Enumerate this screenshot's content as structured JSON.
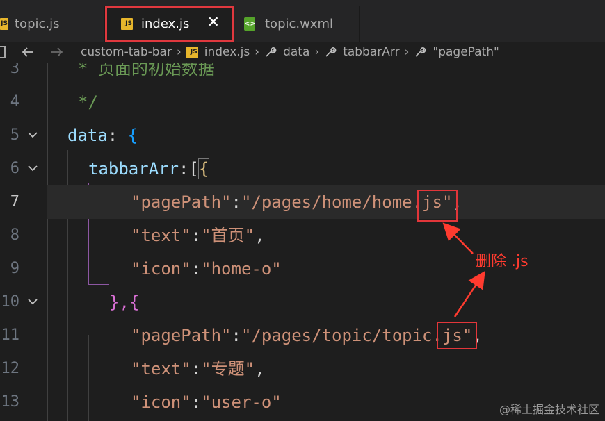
{
  "tabs": [
    {
      "label": "topic.js",
      "icon": "js-file-icon"
    },
    {
      "label": "index.js",
      "icon": "js-file-icon",
      "active": true
    },
    {
      "label": "topic.wxml",
      "icon": "wxml-file-icon"
    }
  ],
  "breadcrumb": {
    "folder": "custom-tab-bar",
    "file": "index.js",
    "symbols": [
      "data",
      "tabbarArr",
      "\"pagePath\""
    ]
  },
  "icons": {
    "js_badge": "JS",
    "wxml_badge": "<>"
  },
  "editor": {
    "current_line": "7",
    "lines": [
      {
        "num": "3",
        "text": "* 页面的初始数据"
      },
      {
        "num": "4",
        "text": "*/"
      },
      {
        "num": "5",
        "key": "data",
        "text": ": "
      },
      {
        "num": "6",
        "key": "tabbarArr",
        "text": ":["
      },
      {
        "num": "7",
        "key": "\"pagePath\"",
        "sep": ":",
        "value": "\"/pages/home/home",
        "highlight": ".js",
        "tail": "\""
      },
      {
        "num": "8",
        "key": "\"text\"",
        "sep": ":",
        "value": "\"首页\""
      },
      {
        "num": "9",
        "key": "\"icon\"",
        "sep": ":",
        "value": "\"home-o\""
      },
      {
        "num": "10",
        "text": "},"
      },
      {
        "num": "11",
        "key": "\"pagePath\"",
        "sep": ":",
        "value": "\"/pages/topic/topic",
        "highlight": ".js",
        "tail": "\""
      },
      {
        "num": "12",
        "key": "\"text\"",
        "sep": ":",
        "value": "\"专题\""
      },
      {
        "num": "13",
        "key": "\"icon\"",
        "sep": ":",
        "value": "\"user-o\""
      }
    ]
  },
  "annotation": "删除 .js",
  "watermark": "@稀土掘金技术社区",
  "colors": {
    "highlight_box": "#e2363a",
    "annotation": "#ff3b2f",
    "string": "#ce9178",
    "key": "#9cdcfe",
    "comment": "#6a9955"
  }
}
